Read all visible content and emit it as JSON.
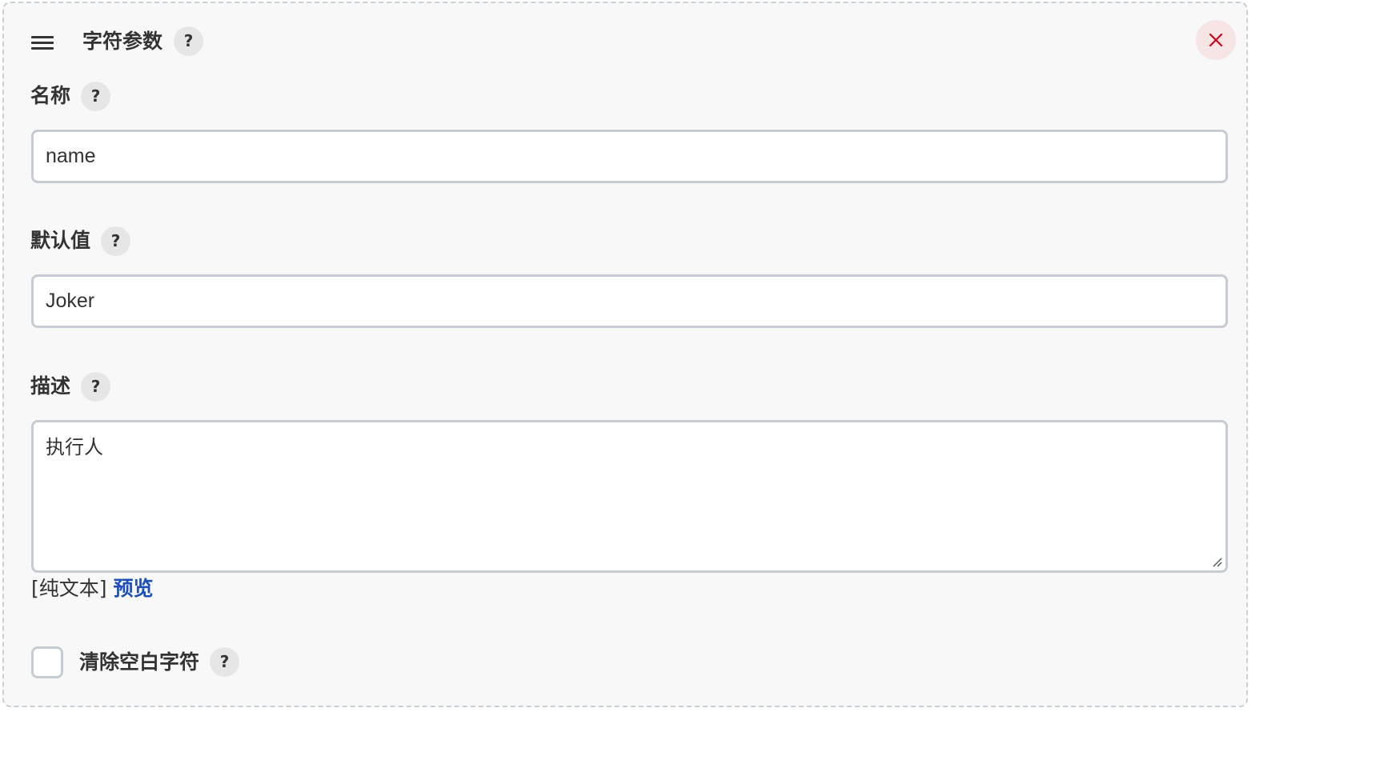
{
  "header": {
    "title": "字符参数",
    "help": "?"
  },
  "fields": {
    "name": {
      "label": "名称",
      "help": "?",
      "value": "name"
    },
    "default_value": {
      "label": "默认值",
      "help": "?",
      "value": "Joker"
    },
    "description": {
      "label": "描述",
      "help": "?",
      "value": "执行人",
      "format_prefix": "[纯文本]",
      "preview_link": "预览"
    }
  },
  "trim_option": {
    "label": "清除空白字符",
    "help": "?",
    "checked": false
  },
  "colors": {
    "panel_background": "#f8f8f8",
    "border": "#c5ccd3",
    "close_background": "#f7e4e5",
    "close_icon": "#d0021b",
    "link": "#1c4fba"
  },
  "icons": {
    "drag_handle": "hamburger-icon",
    "close": "close-icon",
    "resize": "resize-grip-icon"
  }
}
